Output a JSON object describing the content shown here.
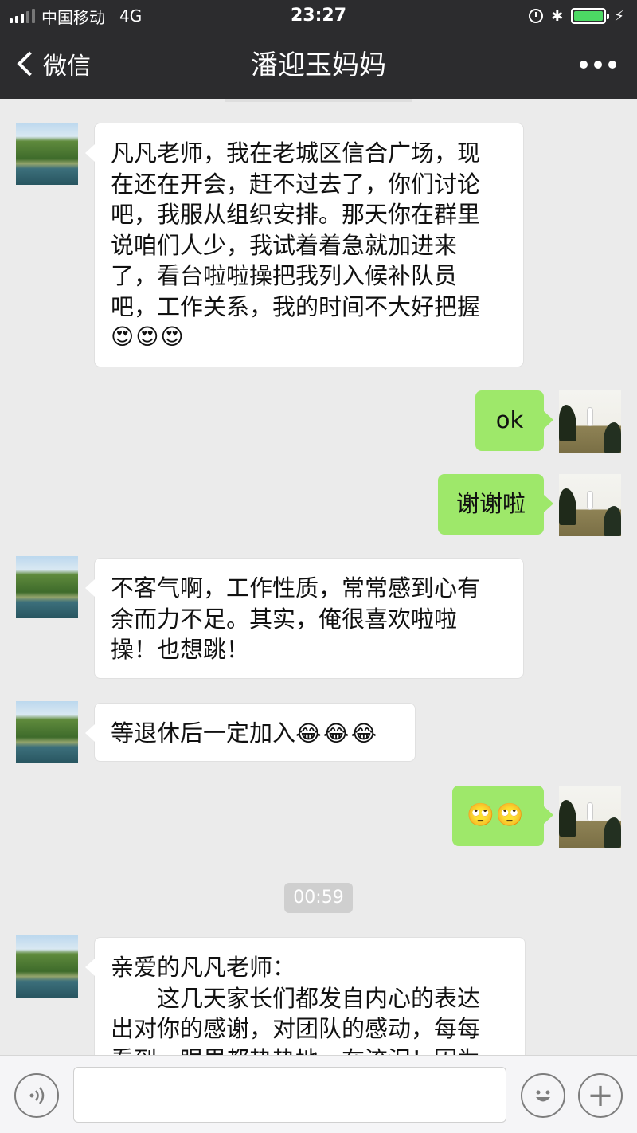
{
  "status_bar": {
    "carrier": "中国移动",
    "network": "4G",
    "time": "23:27",
    "battery_level": 1.0,
    "battery_color": "#4cd964"
  },
  "navbar": {
    "back_label": "微信",
    "title": "潘迎玉妈妈",
    "more_icon": "ellipsis-icon"
  },
  "messages": [
    {
      "side": "left",
      "lines": [
        "凡凡老师，我在老城区信合广场，现",
        "在还在开会，赶不过去了，你们讨论",
        "吧，我服从组织安排。那天你在群里",
        "说咱们人少，我试着着急就加进来",
        "了，看台啦啦操把我列入候补队员",
        "吧，工作关系，我的时间不大好把握"
      ],
      "emoji": "😍😍😍"
    },
    {
      "side": "right",
      "text": "ok"
    },
    {
      "side": "right",
      "text": "谢谢啦"
    },
    {
      "side": "left",
      "lines": [
        "不客气啊，工作性质，常常感到心有",
        "余而力不足。其实，俺很喜欢啦啦",
        "操！也想跳！"
      ]
    },
    {
      "side": "left",
      "text": "等退休后一定加入",
      "emoji": "😂😂😂"
    },
    {
      "side": "right",
      "emoji": "🙄🙄"
    },
    {
      "side": "left",
      "lines": [
        "亲爱的凡凡老师：",
        "　　这几天家长们都发自内心的表达",
        "出对你的感谢，对团队的感动，每每",
        "看到，眼里都热热地，在流泪！因为"
      ]
    }
  ],
  "timestamp_chip": "00:59",
  "colors": {
    "header_bg": "#2c2c2e",
    "chat_bg": "#ebebeb",
    "self_bubble": "#9ee86a",
    "other_bubble": "#ffffff"
  },
  "input_bar": {
    "voice_icon": "voice-icon",
    "emoji_icon": "smiley-icon",
    "plus_icon": "plus-icon",
    "plus_glyph": "+",
    "value": ""
  }
}
